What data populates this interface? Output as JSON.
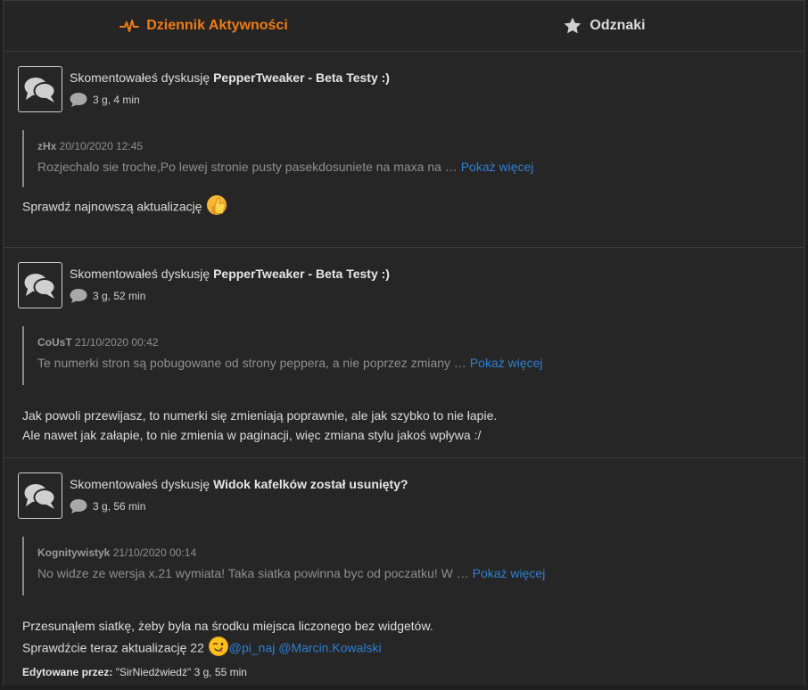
{
  "tabs": {
    "activity": "Dziennik Aktywności",
    "badges": "Odznaki"
  },
  "colors": {
    "accent": "#f07b16",
    "link": "#2f7fd1"
  },
  "entries": [
    {
      "action": "Skomentowałeś dyskusję ",
      "topic": "PepperTweaker - Beta Testy :)",
      "time": "3 g, 4 min",
      "quote_author": "zHx",
      "quote_date": " 20/10/2020 12:45",
      "quote_text": "Rozjechalo sie troche,Po lewej stronie pusty pasekdosuniete na maxa na … ",
      "more": "Pokaż więcej",
      "body_lines": [
        "Sprawdź najnowszą aktualizację "
      ],
      "emoji": "thumbs-up-emoji"
    },
    {
      "action": "Skomentowałeś dyskusję ",
      "topic": "PepperTweaker - Beta Testy :)",
      "time": "3 g, 52 min",
      "quote_author": "CoUsT",
      "quote_date": " 21/10/2020 00:42",
      "quote_text": "Te numerki stron są pobugowane od strony peppera, a nie poprzez zmiany … ",
      "more": "Pokaż więcej",
      "body_lines": [
        "Jak powoli przewijasz, to numerki się zmieniają poprawnie, ale jak szybko to nie łapie.",
        "Ale nawet jak załapie, to nie zmienia w paginacji, więc zmiana stylu jakoś wpływa :/"
      ]
    },
    {
      "action": "Skomentowałeś dyskusję ",
      "topic": "Widok kafelków został usunięty?",
      "time": "3 g, 56 min",
      "quote_author": "Kognitywistyk",
      "quote_date": " 21/10/2020 00:14",
      "quote_text": "No widze ze wersja x.21 wymiata! Taka siatka powinna byc od poczatku! W … ",
      "more": "Pokaż więcej",
      "body_lines": [
        "Przesunąłem siatkę, żeby była na środku miejsca liczonego bez widgetów.",
        "Sprawdźcie teraz aktualizację 22 "
      ],
      "emoji": "winking-emoji",
      "mentions": [
        "@pi_naj",
        "@Marcin.Kowalski"
      ],
      "edited_label": "Edytowane przez:",
      "edited_value": " \"SirNiedźwiedź\" 3 g, 55 min"
    }
  ]
}
